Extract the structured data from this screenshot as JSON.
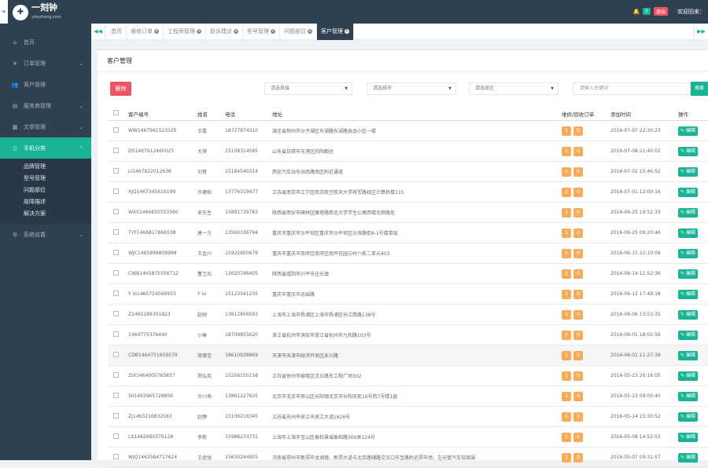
{
  "header": {
    "logo_main": "一刻钟",
    "logo_sub": "yikezhong.com",
    "bell_count": "0",
    "exit_label": "退出",
    "welcome": "欢迎回来：",
    "collapse_icon": "«"
  },
  "sidebar": {
    "items": [
      {
        "icon": "home-icon",
        "glyph": "⌂",
        "label": "首页",
        "chev": ""
      },
      {
        "icon": "yen-icon",
        "glyph": "¥",
        "label": "订单管理",
        "chev": "⌄"
      },
      {
        "icon": "users-icon",
        "glyph": "👥",
        "label": "客户管理",
        "chev": ""
      },
      {
        "icon": "store-icon",
        "glyph": "▤",
        "label": "服务商管理",
        "chev": "⌄"
      },
      {
        "icon": "article-icon",
        "glyph": "▦",
        "label": "文章管理",
        "chev": "⌄"
      },
      {
        "icon": "phone-icon",
        "glyph": "▯",
        "label": "手机分类",
        "chev": "⌃",
        "active": true
      },
      {
        "icon": "gear-icon",
        "glyph": "⚙",
        "label": "系统设置",
        "chev": "⌄"
      }
    ],
    "subitems": [
      "品牌管理",
      "型号管理",
      "问题部位",
      "故障描述",
      "解决方案"
    ]
  },
  "tabs": {
    "prev": "◀◀",
    "next": "▶▶",
    "items": [
      "首页",
      "维修订单",
      "工程师管理",
      "投诉建议",
      "型号管理",
      "问题部位",
      "客户管理"
    ],
    "active_index": 6
  },
  "panel": {
    "title": "客户管理",
    "delete_label": "删除",
    "province_placeholder": "请选择省",
    "city_placeholder": "请选择市",
    "district_placeholder": "请选择区",
    "search_placeholder": "请输入关键词",
    "search_label": "搜索"
  },
  "table": {
    "headers": [
      "客户编号",
      "姓名",
      "电话",
      "地址",
      "维修/回收订单",
      "添加时间",
      "操作"
    ],
    "edit_label": "编辑",
    "rows": [
      {
        "id": "WW1467961523105",
        "name": "王磊",
        "phone": "18727874310",
        "addr": "湖北省荆州市沙子湖区东湖路东湖路食品小区一楼",
        "a": "1",
        "b": "0",
        "time": "2016-07-07 22:30:23"
      },
      {
        "id": "DS1467912460025",
        "name": "大琪",
        "phone": "15108314585",
        "addr": "山东省日照市东港区的阳朝达",
        "a": "1",
        "b": "0",
        "time": "2016-07-08 21:40:02"
      },
      {
        "id": "LI1467822012638",
        "name": "刘哥",
        "phone": "15184540314",
        "addr": "西安汽车站东站南路南区附近通道",
        "a": "1",
        "b": "0",
        "time": "2016-07-02 15:46:52"
      },
      {
        "id": "XJQ1467345616190",
        "name": "许建秋",
        "phone": "13776319477",
        "addr": "江苏省南京市江宁区南京航空航天大学将军路校区计算机楼115",
        "a": "1",
        "b": "0",
        "time": "2016-07-01 12:00:16"
      },
      {
        "id": "WXS1466855553360",
        "name": "吴先生",
        "phone": "15891739783",
        "addr": "陕西省西安市碑林区雁塔路西北大学学生公寓西楼北侧路处",
        "a": "1",
        "b": "0",
        "time": "2016-06-25 19:52:33"
      },
      {
        "id": "TYF1466817866538",
        "name": "唐一方",
        "phone": "13560336794",
        "addr": "重庆市重庆市沙坪坝区重庆市沙坪坝区沙滨路街8-1号楼单层",
        "a": "1",
        "b": "0",
        "time": "2016-06-25 09:20:46"
      },
      {
        "id": "WJC1465999809998",
        "name": "王金川",
        "phone": "15922900679",
        "addr": "重庆市重庆市南岸区南岸区南坪花园三村八栋二单元403",
        "a": "1",
        "b": "0",
        "time": "2016-06-15 22:10:09"
      },
      {
        "id": "CWB1465875556712",
        "name": "曹卫兵",
        "phone": "13020746405",
        "addr": "陕西省咸阳市兴平市庄头镇",
        "a": "1",
        "b": "0",
        "time": "2016-06-14 11:52:36"
      },
      {
        "id": "Y io1465724566933",
        "name": "Y io",
        "phone": "15123541235",
        "addr": "重庆市重庆市北碚路",
        "a": "1",
        "b": "0",
        "time": "2016-06-12 17:49:18"
      },
      {
        "id": "Z1465189301823",
        "name": "赵刚",
        "phone": "13612856593",
        "addr": "上海市上海市杨浦区上海市杨浦区长江西路138号",
        "a": "1",
        "b": "0",
        "time": "2016-06-06 13:53:35"
      },
      {
        "id": "1464775376440",
        "name": "小琳",
        "phone": "18709855620",
        "addr": "浙江省杭州市滨安市浙江省杭州市九和路103号",
        "a": "1",
        "b": "0",
        "time": "2016-06-01 18:02:56"
      },
      {
        "id": "CDB1464751659579",
        "name": "常德宝",
        "phone": "18610938869",
        "addr": "天津市天津市经济开发区永兴路",
        "a": "1",
        "b": "0",
        "time": "2016-06-01 11:27:39",
        "hl": true
      },
      {
        "id": "ZIX1464005765857",
        "name": "郑弘宪",
        "phone": "15256150158",
        "addr": "江苏省徐州市鼓楼区沈丘路东工程广场302",
        "a": "1",
        "b": "0",
        "time": "2016-05-23 20:16:05"
      },
      {
        "id": "SII1463965728856",
        "name": "佘川寿",
        "phone": "13861227625",
        "addr": "北京市北京市房山区长阳镇北京市长阳天街16号院7号楼1层",
        "a": "1",
        "b": "0",
        "time": "2016-05-23 09:00:40"
      },
      {
        "id": "ZJ1463216832583",
        "name": "赵静",
        "phone": "15106216345",
        "addr": "江苏省苏州市吴江市吴江大道1626号",
        "a": "1",
        "b": "1",
        "time": "2016-05-14 15:30:52"
      },
      {
        "id": "LX1462680375128",
        "name": "李新",
        "phone": "15988233731",
        "addr": "上海市上海市宝山区泰和景城泰和路300弄124号",
        "a": "1",
        "b": "0",
        "time": "2016-05-08 14:52:55"
      },
      {
        "id": "WJQ1462584717624",
        "name": "王金锐",
        "phone": "15630294925",
        "addr": "河南省郑州市新郑市龙湖镇，新郑大道与北京路辅路交叉口东宝路附近郑市场，左光管汽车馆周围",
        "a": "1",
        "b": "0",
        "time": "2016-05-07 09:31:57"
      }
    ]
  }
}
